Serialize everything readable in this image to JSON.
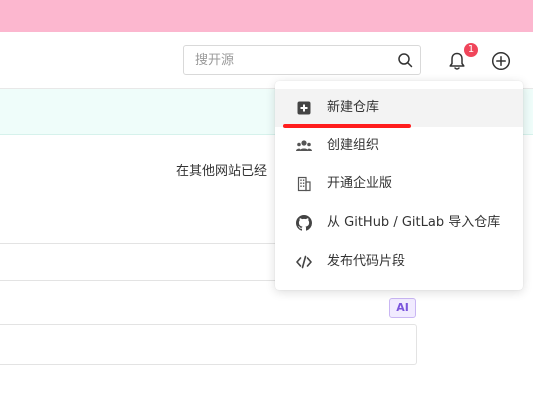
{
  "header": {
    "search_placeholder": "搜开源",
    "notification_count": "1"
  },
  "main": {
    "partial_text": "在其他网站已经",
    "ai_badge": "AI"
  },
  "create_menu": {
    "items": [
      {
        "label": "新建仓库",
        "icon": "plus-square-icon"
      },
      {
        "label": "创建组织",
        "icon": "users-icon"
      },
      {
        "label": "开通企业版",
        "icon": "building-icon"
      },
      {
        "label": "从 GitHub / GitLab 导入仓库",
        "icon": "github-icon"
      },
      {
        "label": "发布代码片段",
        "icon": "code-icon"
      }
    ],
    "highlighted_item": "新建仓库"
  },
  "colors": {
    "top_banner": "#fcb7cf",
    "notice_bar": "#effdfa",
    "badge": "#f0455a",
    "highlight_underline": "#ff1d1d",
    "ai_badge": "#7b55dc"
  }
}
